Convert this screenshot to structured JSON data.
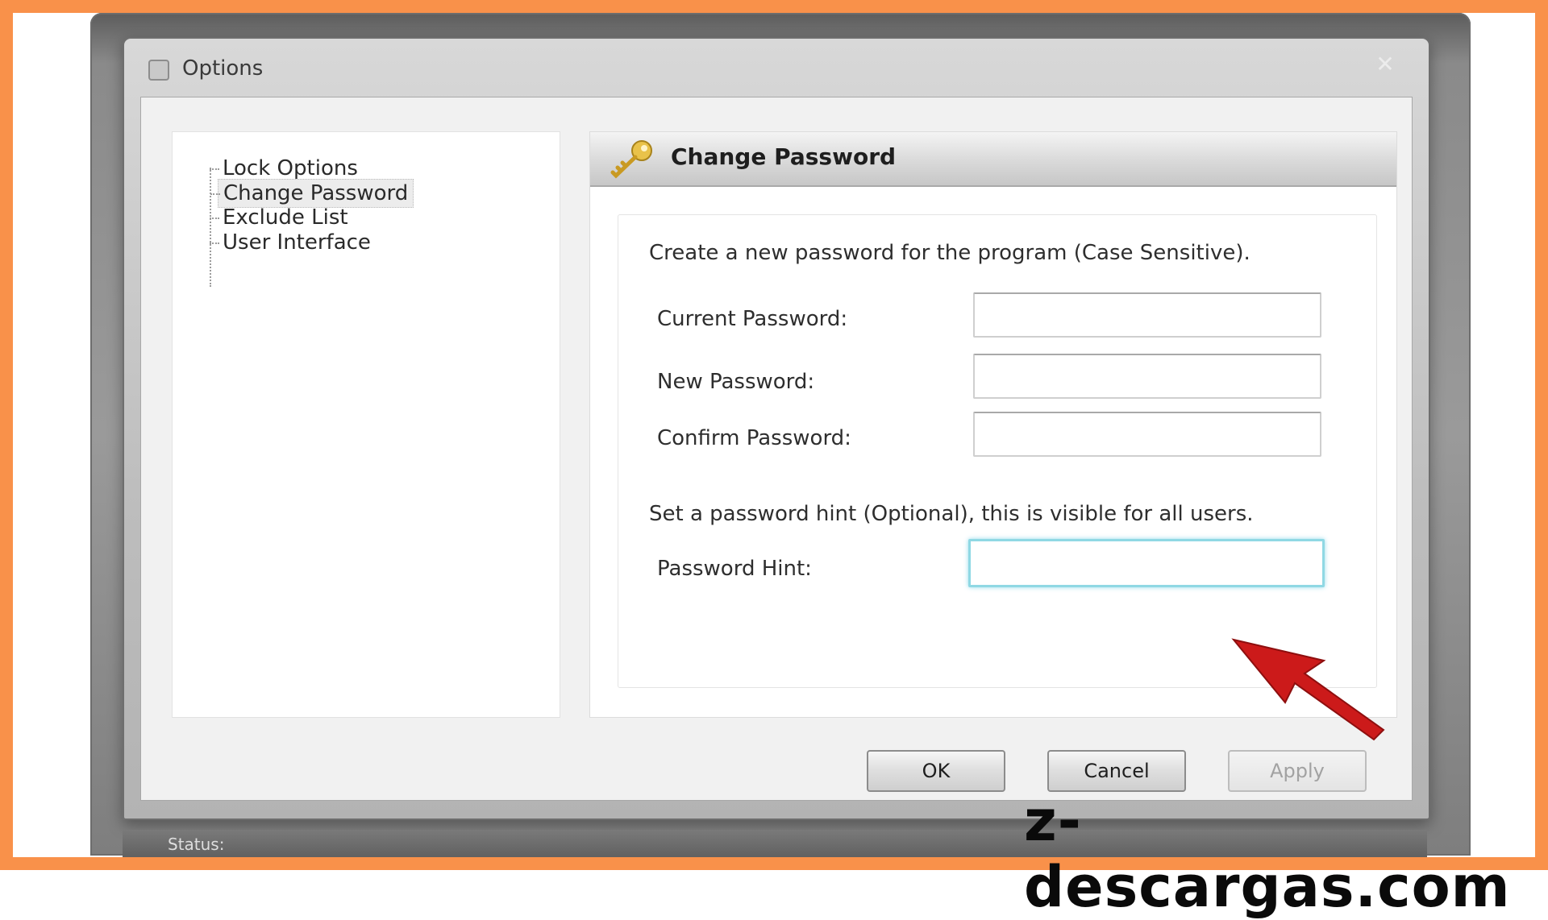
{
  "dialog": {
    "title": "Options",
    "close_glyph": "✕"
  },
  "tree": {
    "items": [
      {
        "label": "Lock Options",
        "selected": false
      },
      {
        "label": "Change Password",
        "selected": true
      },
      {
        "label": "Exclude List",
        "selected": false
      },
      {
        "label": "User Interface",
        "selected": false
      }
    ]
  },
  "panel": {
    "title": "Change Password",
    "icon": "key-icon",
    "instruction_1": "Create a new password for the program (Case Sensitive).",
    "fields": [
      {
        "label": "Current Password:",
        "value": ""
      },
      {
        "label": "New Password:",
        "value": ""
      },
      {
        "label": "Confirm Password:",
        "value": ""
      }
    ],
    "instruction_2": "Set a password hint (Optional), this is visible for all users.",
    "hint_field": {
      "label": "Password Hint:",
      "value": "",
      "focused": true
    }
  },
  "buttons": {
    "ok": "OK",
    "cancel": "Cancel",
    "apply": "Apply",
    "apply_enabled": false
  },
  "statusbar": {
    "label": "Status:"
  },
  "annotation": {
    "arrow_color": "#cc1a1a",
    "points_to": "password-hint-input"
  },
  "colors": {
    "frame": "#f9914a",
    "focus_ring": "#8fd8e4"
  },
  "watermark": "z-descargas.com"
}
